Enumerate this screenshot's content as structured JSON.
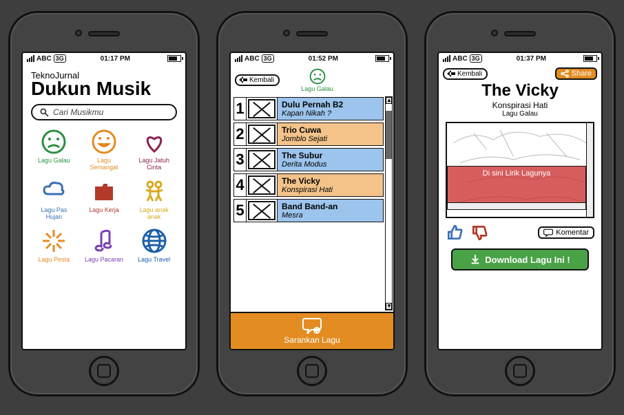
{
  "status": {
    "carrier": "ABC",
    "net": "3G",
    "time1": "01:17 PM",
    "time2": "01:52 PM",
    "time3": "01:37 PM"
  },
  "screen1": {
    "subtitle": "TeknoJurnal",
    "title": "Dukun Musik",
    "search_placeholder": "Cari Musikmu",
    "categories": [
      {
        "id": "lagu-galau",
        "label": "Lagu Galau",
        "color": "#2a8f3f"
      },
      {
        "id": "lagu-semangat",
        "label": "Lagu Semangat",
        "color": "#e28c22"
      },
      {
        "id": "lagu-jatuh-cinta",
        "label": "Lagu Jatuh Cinta",
        "color": "#8a2050"
      },
      {
        "id": "lagu-pas-hujan",
        "label": "Lagu Pas Hujan",
        "color": "#3a6fb5"
      },
      {
        "id": "lagu-kerja",
        "label": "Lagu Kerja",
        "color": "#b33a2a"
      },
      {
        "id": "lagu-anak-anak",
        "label": "Lagu anak anak",
        "color": "#d9aa1e"
      },
      {
        "id": "lagu-pesta",
        "label": "Lagu Pesta",
        "color": "#e28c22"
      },
      {
        "id": "lagu-pacaran",
        "label": "Lagu Pacaran",
        "color": "#7a3fb0"
      },
      {
        "id": "lagu-travel",
        "label": "Lagu Travel",
        "color": "#1c5fa8"
      }
    ]
  },
  "screen2": {
    "back": "Kembali",
    "mood_label": "Lagu Galau",
    "songs": [
      {
        "n": "1",
        "title": "Dulu Pernah B2",
        "sub": "Kapan Nikah ?",
        "tone": "blue"
      },
      {
        "n": "2",
        "title": "Trio Cuwa",
        "sub": "Jomblo Sejati",
        "tone": "orange"
      },
      {
        "n": "3",
        "title": "The Subur",
        "sub": "Derita Modus",
        "tone": "blue"
      },
      {
        "n": "4",
        "title": "The Vicky",
        "sub": "Konspirasi Hati",
        "tone": "orange"
      },
      {
        "n": "5",
        "title": "Band Band-an",
        "sub": "Mesra",
        "tone": "blue"
      }
    ],
    "suggest": "Sarankan Lagu"
  },
  "screen3": {
    "back": "Kembali",
    "share": "Share",
    "artist": "The Vicky",
    "song": "Konspirasi Hati",
    "mood": "Lagu Galau",
    "lyric_caption": "Di sini Lirik Lagunya",
    "comment": "Komentar",
    "download": "Download Lagu Ini !"
  }
}
